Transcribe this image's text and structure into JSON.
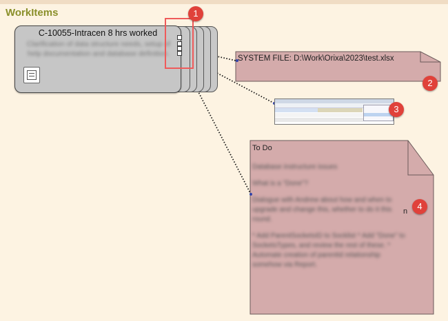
{
  "section": {
    "title": "WorkItems"
  },
  "work_item": {
    "title": "C-10055-Intracen 8 hrs worked",
    "description": "Clarification of data structure needs, setup of help documentation and database definition."
  },
  "file_note": {
    "text": "SYSTEM FILE: D:\\Work\\Orixa\\2023\\test.xlsx"
  },
  "todo_note": {
    "title": "To Do",
    "visible_fragment": "n",
    "body_blurred": [
      "Database instructure issues",
      "What is a \"Done\"?",
      "Dialogue with Andrew about how and when to upgrade and change this, whether to do it this round.",
      "* Add ParentSocketsID to Socklist * Add \"Done\" to SocketsTypes, and review the rest of these. * Automate creation of parentId relationship somehow via Report."
    ]
  },
  "annotations": {
    "badges": [
      "1",
      "2",
      "3",
      "4"
    ]
  },
  "colors": {
    "background": "#fdf3e2",
    "title": "#8a8f2a",
    "card": "#c6c6c6",
    "note": "#d4abab",
    "callout": "#e0413a"
  },
  "icons": [
    "document-icon",
    "screenshot-thumbnail"
  ]
}
